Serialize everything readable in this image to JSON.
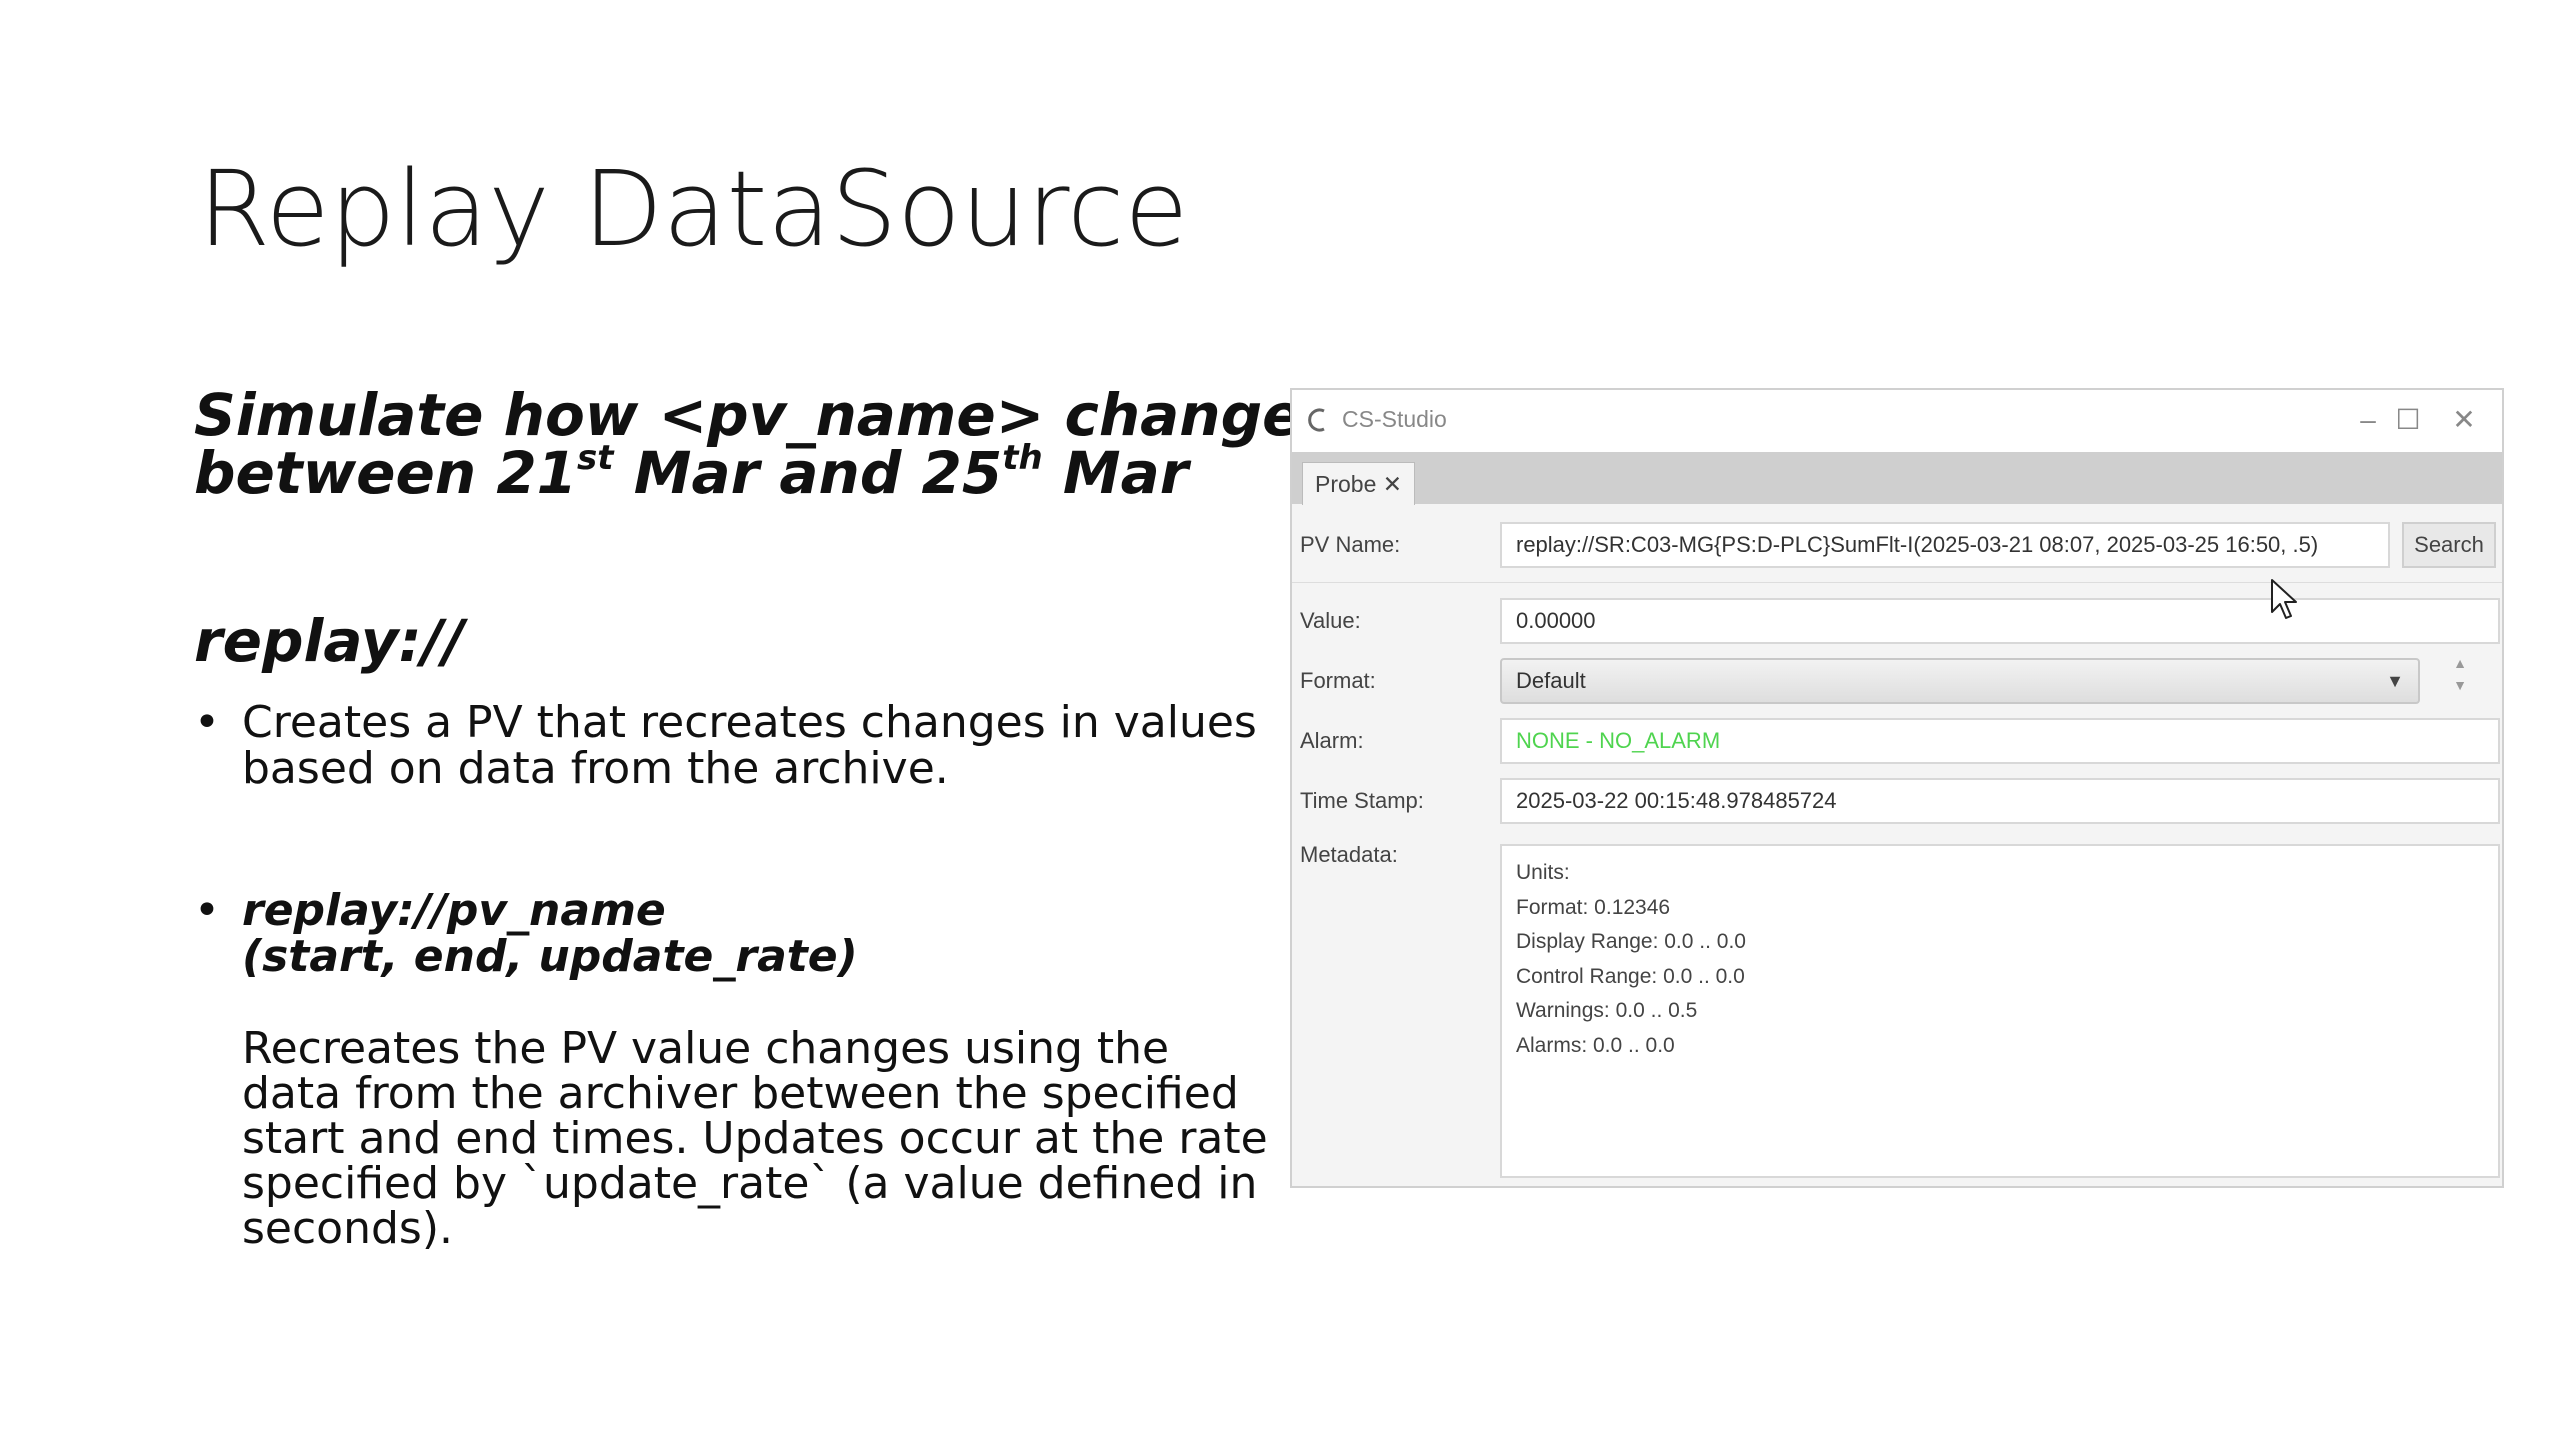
{
  "slide": {
    "title": "Replay DataSource",
    "heading1": {
      "line1": "Simulate how <pv_name> changed",
      "line2_a": "between 21",
      "line2_sup1": "st",
      "line2_b": " Mar and 25",
      "line2_sup2": "th",
      "line2_c": " Mar"
    },
    "heading2": "replay://",
    "bullet_char": "•",
    "bullet1": [
      "Creates a PV that recreates changes in values",
      "based on data from the archive."
    ],
    "bullet2": [
      "replay://pv_name",
      "(start, end, update_rate)"
    ],
    "paragraph": [
      "Recreates the PV value changes using the",
      "data from the archiver between the specified",
      "start and end times. Updates occur at the rate",
      "specified by `update_rate` (a value defined in",
      "seconds)."
    ]
  },
  "window": {
    "app_title": "CS-Studio",
    "controls": {
      "minimize": "–",
      "maximize": "☐",
      "close": "✕"
    },
    "tab_label": "Probe ✕",
    "pv_name_label": "PV Name:",
    "pv_name_value": "replay://SR:C03-MG{PS:D-PLC}SumFlt-I(2025-03-21 08:07, 2025-03-25 16:50, .5)",
    "search_label": "Search",
    "value_label": "Value:",
    "value_value": "0.00000",
    "format_label": "Format:",
    "format_value": "Default",
    "alarm_label": "Alarm:",
    "alarm_value": "NONE - NO_ALARM",
    "alarm_color": "#4fd44f",
    "timestamp_label": "Time Stamp:",
    "timestamp_value": "2025-03-22 00:15:48.978485724",
    "metadata_label": "Metadata:",
    "metadata_lines": [
      "Units:",
      "Format: 0.12346",
      "Display Range: 0.0 .. 0.0",
      "Control Range: 0.0 .. 0.0",
      "Warnings: 0.0 .. 0.5",
      "Alarms: 0.0 .. 0.0"
    ]
  }
}
